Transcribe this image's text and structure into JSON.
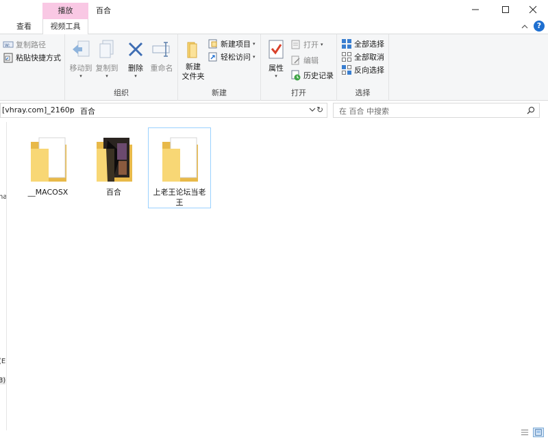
{
  "window": {
    "title": "百合",
    "context_tab_header": "播放"
  },
  "ribbon_tabs": [
    {
      "label": "查看"
    },
    {
      "label": "视频工具"
    }
  ],
  "ribbon": {
    "clipboard_partial": {
      "copy_path": "复制路径",
      "paste_shortcut": "粘贴快捷方式"
    },
    "organize": {
      "label": "组织",
      "move_to": "移动到",
      "copy_to": "复制到",
      "delete": "删除",
      "rename": "重命名"
    },
    "new": {
      "label": "新建",
      "new_folder_line1": "新建",
      "new_folder_line2": "文件夹",
      "new_item": "新建项目",
      "easy_access": "轻松访问"
    },
    "open": {
      "label": "打开",
      "properties": "属性",
      "open": "打开",
      "edit": "编辑",
      "history": "历史记录"
    },
    "select": {
      "label": "选择",
      "select_all": "全部选择",
      "select_none": "全部取消",
      "invert": "反向选择"
    }
  },
  "address": {
    "crumb_parent": "[vhray.com]_2160p",
    "crumb_current": "百合"
  },
  "search": {
    "placeholder": "在 百合 中搜索"
  },
  "nav_fragments": {
    "a": "na",
    "b": "(E",
    "c": "3)"
  },
  "items": [
    {
      "name": "__MACOSX"
    },
    {
      "name": "百合"
    },
    {
      "name": "上老王论坛当老王"
    }
  ],
  "colors": {
    "context_tab": "#f9c8e4",
    "selection_border": "#99d1ff",
    "folder_yellow": "#f8d775",
    "help_blue": "#1e6fd0"
  }
}
